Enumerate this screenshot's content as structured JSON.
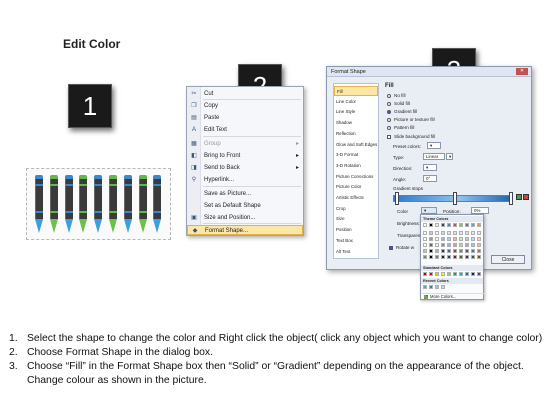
{
  "heading": "Edit Color",
  "badges": [
    "1",
    "2",
    "3"
  ],
  "crayons": {
    "count": 9,
    "colors": {
      "body": "#3a3a3a",
      "tip": "#6ec04a",
      "cap_blue": "#3a88d0",
      "cap_green": "#62b64a"
    }
  },
  "context_menu": {
    "items": [
      {
        "icon": "scissors-icon",
        "label": "Cut",
        "disabled": false
      },
      {
        "icon": "copy-icon",
        "label": "Copy",
        "disabled": false
      },
      {
        "icon": "paste-icon",
        "label": "Paste",
        "disabled": false
      },
      {
        "icon": "edit-text-icon",
        "label": "Edit Text",
        "disabled": false
      },
      {
        "icon": "group-icon",
        "label": "Group",
        "disabled": true,
        "submenu": true
      },
      {
        "icon": "bring-front-icon",
        "label": "Bring to Front",
        "disabled": false,
        "submenu": true
      },
      {
        "icon": "send-back-icon",
        "label": "Send to Back",
        "disabled": false,
        "submenu": true
      },
      {
        "icon": "hyperlink-icon",
        "label": "Hyperlink...",
        "disabled": false
      },
      {
        "icon": "",
        "label": "Save as Picture...",
        "disabled": false
      },
      {
        "icon": "",
        "label": "Set as Default Shape",
        "disabled": false
      },
      {
        "icon": "size-icon",
        "label": "Size and Position...",
        "disabled": false
      },
      {
        "icon": "format-shape-icon",
        "label": "Format Shape...",
        "disabled": false,
        "highlighted": true
      }
    ]
  },
  "format_dialog": {
    "title": "Format Shape",
    "categories": [
      "Fill",
      "Line Color",
      "Line Style",
      "Shadow",
      "Reflection",
      "Glow and Soft Edges",
      "3-D Format",
      "3-D Rotation",
      "Picture Corrections",
      "Picture Color",
      "Artistic Effects",
      "Crop",
      "Size",
      "Position",
      "Text Box",
      "Alt Text"
    ],
    "selected_category": "Fill",
    "fill_header": "Fill",
    "fill_options": [
      "No fill",
      "Solid fill",
      "Gradient fill",
      "Picture or texture fill",
      "Pattern fill"
    ],
    "selected_fill": "Gradient fill",
    "slide_background": "Slide background fill",
    "preset_label": "Preset colors:",
    "type_label": "Type:",
    "type_value": "Linear",
    "direction_label": "Direction:",
    "angle_label": "Angle:",
    "angle_value": "0°",
    "gradient_stops_label": "Gradient stops",
    "color_label": "Color",
    "position_label": "Position:",
    "position_value": "0%",
    "brightness_label": "Brightness:",
    "transparency_label": "Transparency:",
    "rotate_label": "Rotate w",
    "close_label": "Close"
  },
  "palette": {
    "theme_header": "Theme Colors",
    "standard_header": "Standard Colors",
    "recent_header": "Recent Colors",
    "more_label": "More Colors...",
    "theme_top": [
      "#ffffff",
      "#000000",
      "#eeece1",
      "#1f497d",
      "#4f81bd",
      "#c0504d",
      "#9bbb59",
      "#8064a2",
      "#4bacc6",
      "#f79646"
    ],
    "standard": [
      "#c00000",
      "#ff0000",
      "#ffc000",
      "#ffff00",
      "#92d050",
      "#00b050",
      "#00b0f0",
      "#0070c0",
      "#002060",
      "#7030a0"
    ],
    "recent": [
      "#4bacc6",
      "#31859c",
      "#92cddc",
      "#b7dde8"
    ]
  },
  "instructions": [
    {
      "num": "1.",
      "text": "Select the shape to change the color and Right click the object( click any object which you want to change color)"
    },
    {
      "num": "2.",
      "text": "Choose Format Shape in the dialog box."
    },
    {
      "num": "3.",
      "text": "Choose “Fill” in the Format Shape box then “Solid” or “Gradient” depending on the appearance of the object. Change colour as shown in the picture."
    }
  ]
}
